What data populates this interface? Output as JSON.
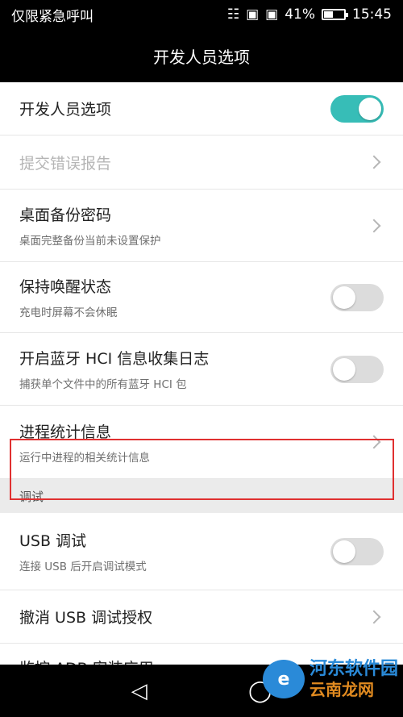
{
  "status_bar": {
    "carrier": "仅限紧急呼叫",
    "battery_percent": "41%",
    "time": "15:45"
  },
  "title": "开发人员选项",
  "rows": [
    {
      "title": "开发人员选项",
      "subtitle": "",
      "control": "toggle",
      "checked": true
    },
    {
      "title": "提交错误报告",
      "subtitle": "",
      "control": "chevron",
      "disabled": true
    },
    {
      "title": "桌面备份密码",
      "subtitle": "桌面完整备份当前未设置保护",
      "control": "chevron"
    },
    {
      "title": "保持唤醒状态",
      "subtitle": "充电时屏幕不会休眠",
      "control": "toggle",
      "checked": false
    },
    {
      "title": "开启蓝牙 HCI 信息收集日志",
      "subtitle": "捕获单个文件中的所有蓝牙 HCI 包",
      "control": "toggle",
      "checked": false
    },
    {
      "title": "进程统计信息",
      "subtitle": "运行中进程的相关统计信息",
      "control": "chevron"
    }
  ],
  "section_header": "调试",
  "debug_rows": [
    {
      "title": "USB 调试",
      "subtitle": "连接 USB 后开启调试模式",
      "control": "toggle",
      "checked": false
    },
    {
      "title": "撤消 USB 调试授权",
      "subtitle": "",
      "control": "chevron"
    },
    {
      "title": "监控 ADB 安装应用",
      "subtitle": "",
      "control": "none"
    }
  ],
  "watermark": {
    "line1": "河东软件园",
    "line2": "云南龙网"
  },
  "colors": {
    "accent": "#37bdb7",
    "highlight": "#e03030"
  }
}
